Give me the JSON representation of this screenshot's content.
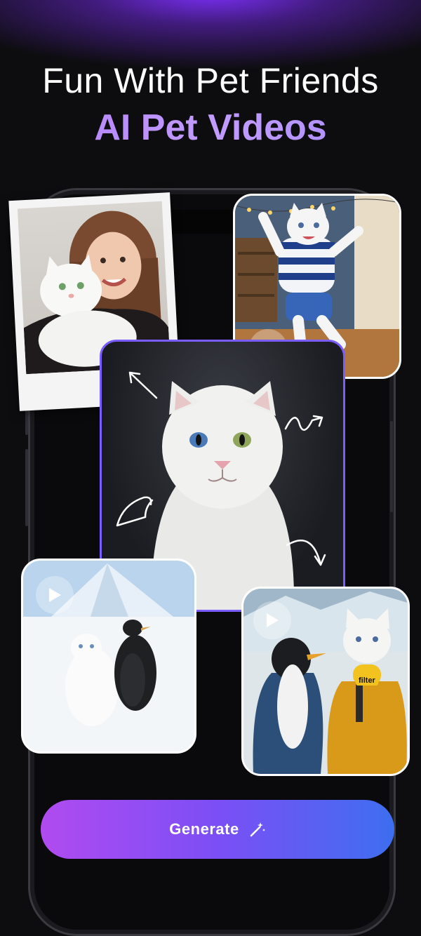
{
  "header": {
    "title": "Fun With Pet Friends",
    "subtitle": "AI Pet Videos"
  },
  "cards": {
    "top_right_badge": "filter",
    "video_cards": [
      {
        "id": "dancing-cat",
        "has_play": true
      },
      {
        "id": "arctic-cat-penguin",
        "has_play": true
      },
      {
        "id": "reporter-cat-penguin",
        "has_play": true
      }
    ]
  },
  "cta": {
    "label": "Generate",
    "icon": "magic-wand-icon"
  },
  "colors": {
    "accent_purple": "#b07cf7",
    "button_gradient_start": "#b04bf0",
    "button_gradient_end": "#3e6ef0",
    "center_card_border": "#7b5cff",
    "background": "#0d0d0f"
  }
}
